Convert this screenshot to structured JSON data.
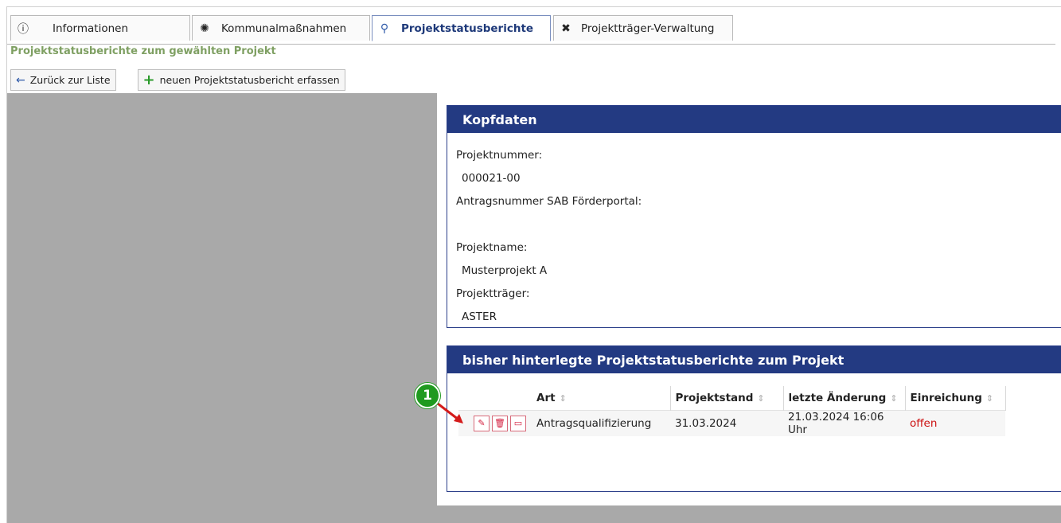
{
  "tabs": [
    {
      "label": "Informationen",
      "icon": "info-icon",
      "glyph": "ⓘ"
    },
    {
      "label": "Kommunalmaßnahmen",
      "icon": "lightbulb-icon",
      "glyph": "💡"
    },
    {
      "label": "Projektstatusberichte",
      "icon": "workflow-icon",
      "glyph": "⚙"
    },
    {
      "label": "Projektträger-Verwaltung",
      "icon": "tools-icon",
      "glyph": "✖"
    }
  ],
  "active_tab": "Projektstatusberichte",
  "subtitle": "Projektstatusberichte zum gewählten Projekt",
  "toolbar": {
    "back_label": "Zurück zur Liste",
    "new_label": "neuen Projektstatusbericht erfassen"
  },
  "kopfdaten": {
    "title": "Kopfdaten",
    "projektnummer_label": "Projektnummer:",
    "projektnummer": "000021-00",
    "antragsnummer_label": "Antragsnummer SAB Förderportal:",
    "antragsnummer": "",
    "projektname_label": "Projektname:",
    "projektname": "Musterprojekt A",
    "projekttraeger_label": "Projektträger:",
    "projekttraeger": "ASTER"
  },
  "reports": {
    "title": "bisher hinterlegte Projektstatusberichte zum Projekt",
    "columns": [
      "Art",
      "Projektstand",
      "letzte Änderung",
      "Einreichung"
    ],
    "rows": [
      {
        "art": "Antragsqualifizierung",
        "projektstand": "31.03.2024",
        "letzte_aenderung": "21.03.2024 16:06 Uhr",
        "einreichung": "offen"
      }
    ]
  },
  "annotation": {
    "marker": "1"
  },
  "colors": {
    "header": "#233a82",
    "subtitle": "#7fa063",
    "status_open": "#cc1111",
    "marker": "#1f9a1f"
  }
}
